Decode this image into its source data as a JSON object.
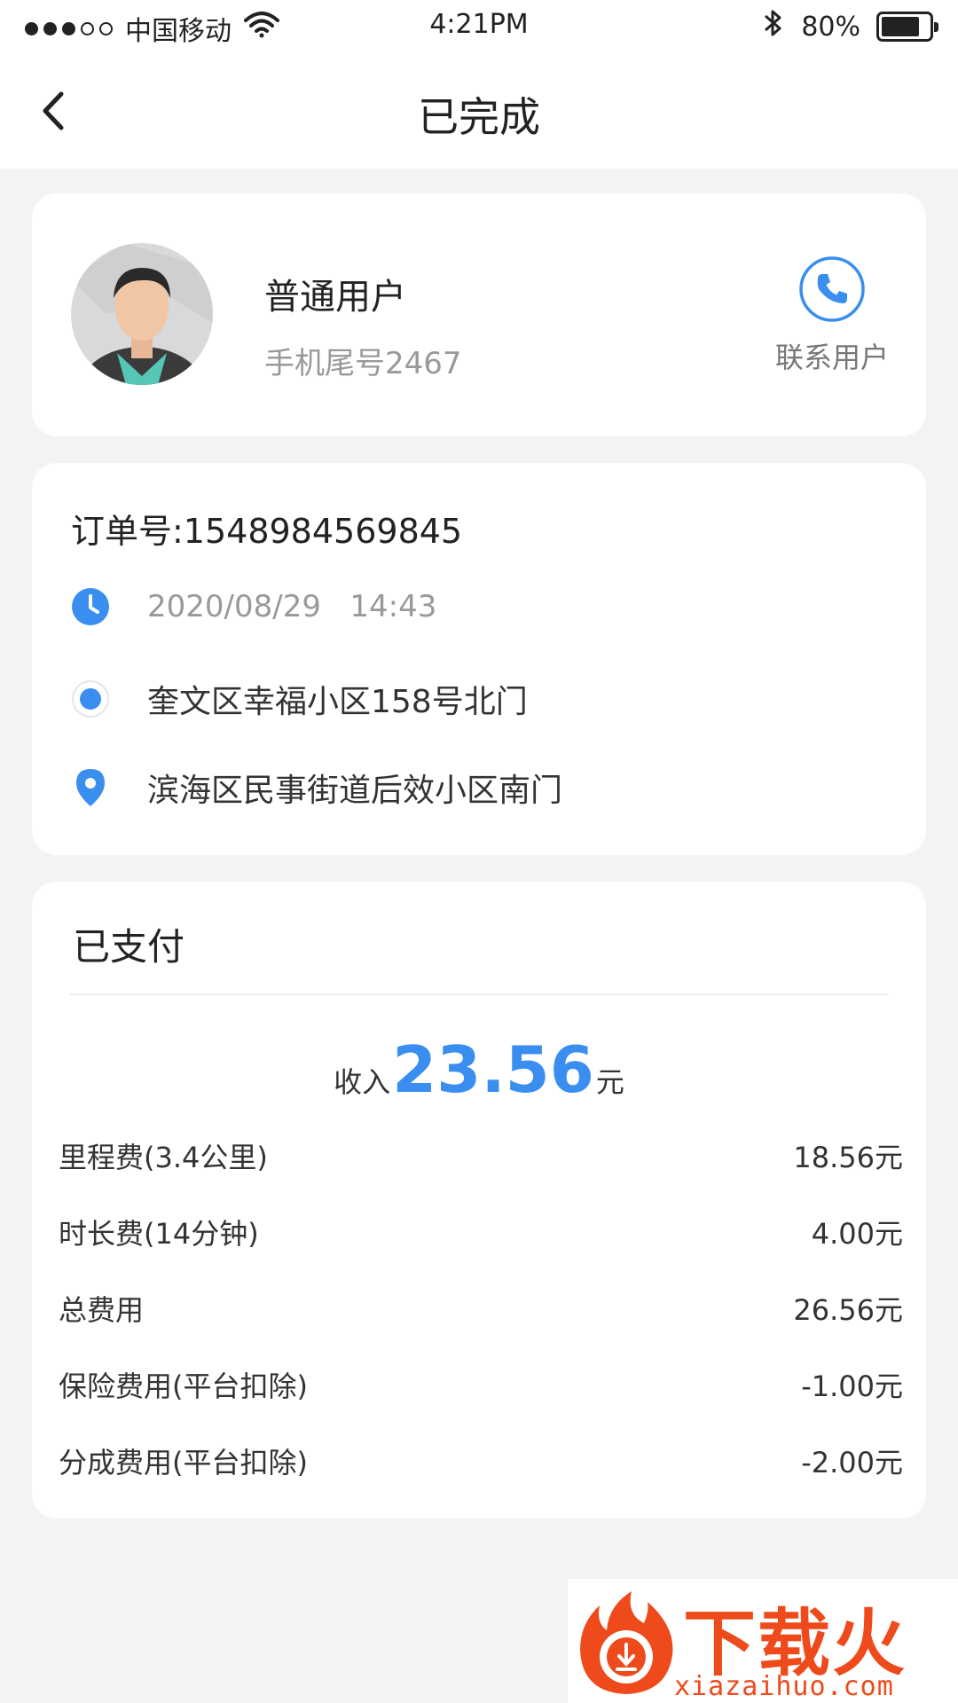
{
  "status_bar": {
    "carrier": "中国移动",
    "time": "4:21PM",
    "battery_percent": "80%",
    "battery_level": 0.8,
    "signal_bars": 3
  },
  "nav": {
    "title": "已完成",
    "back_icon": "chevron-left-icon"
  },
  "user": {
    "name": "普通用户",
    "phone_tail": "手机尾号2467",
    "contact_label": "联系用户"
  },
  "order": {
    "number_text": "订单号:1548984569845",
    "datetime": "2020/08/29   14:43",
    "start_address": "奎文区幸福小区158号北门",
    "end_address": "滨海区民事街道后效小区南门"
  },
  "payment": {
    "status": "已支付",
    "income_label": "收入",
    "income_amount": "23.56",
    "income_unit": "元",
    "fees": [
      {
        "label": "里程费(3.4公里)",
        "value": "18.56元"
      },
      {
        "label": "时长费(14分钟)",
        "value": "4.00元"
      },
      {
        "label": "总费用",
        "value": "26.56元"
      },
      {
        "label": "保险费用(平台扣除)",
        "value": "-1.00元"
      },
      {
        "label": "分成费用(平台扣除)",
        "value": "-2.00元"
      }
    ]
  },
  "watermark": {
    "name": "下载火",
    "url": "xiazaihuo.com"
  },
  "colors": {
    "accent": "#3a8ef0",
    "background": "#f3f3f3",
    "card": "#ffffff",
    "watermark": "#ee4a1b"
  }
}
